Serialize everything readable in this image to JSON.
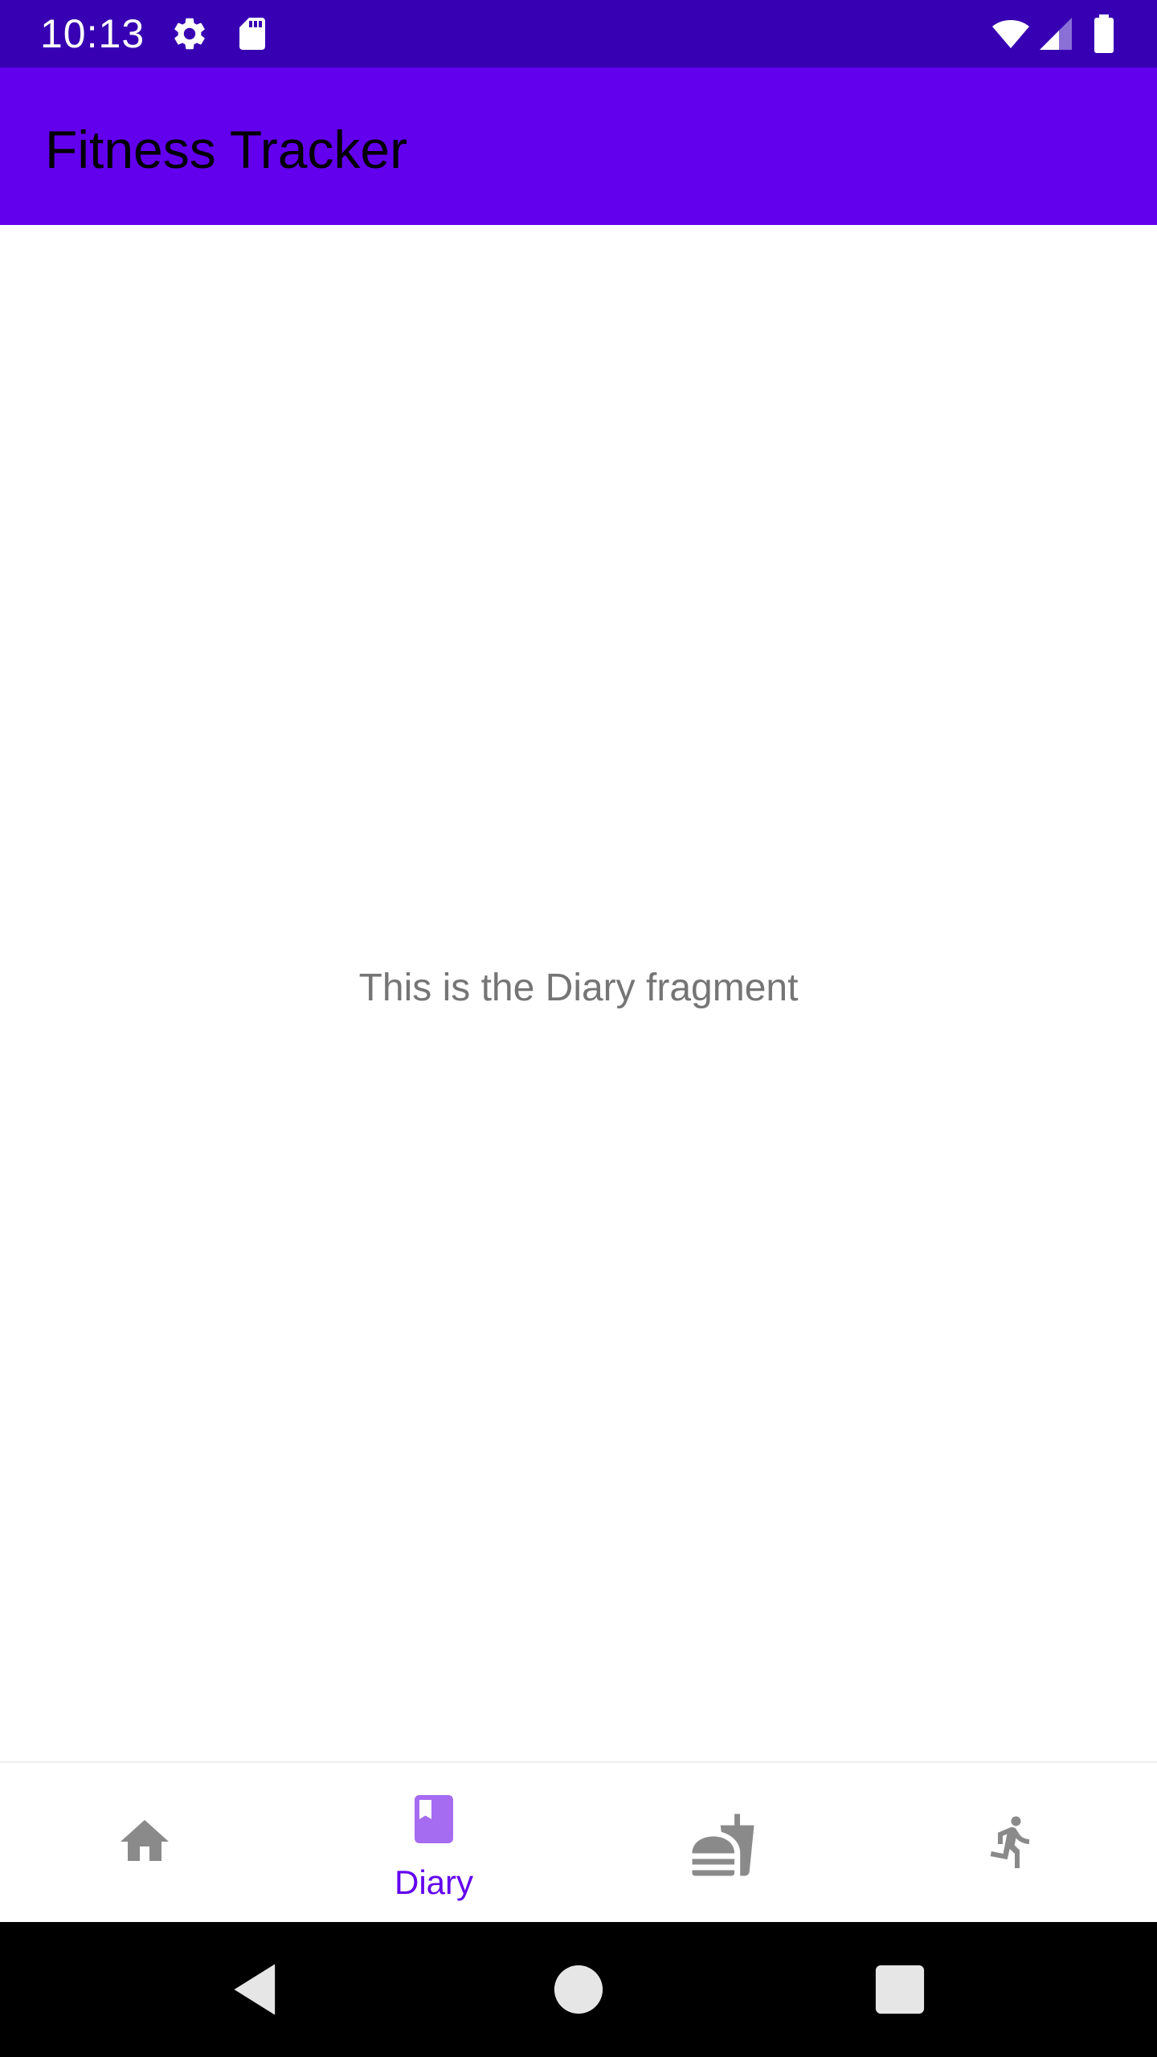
{
  "status_bar": {
    "time": "10:13",
    "icons": [
      "settings-icon",
      "sd-card-icon",
      "wifi-icon",
      "cellular-signal-icon",
      "battery-icon"
    ]
  },
  "app_bar": {
    "title": "Fitness Tracker"
  },
  "content": {
    "message": "This is the Diary fragment"
  },
  "bottom_nav": {
    "selected_index": 1,
    "items": [
      {
        "icon": "home-icon",
        "label": ""
      },
      {
        "icon": "book-icon",
        "label": "Diary"
      },
      {
        "icon": "fastfood-icon",
        "label": ""
      },
      {
        "icon": "run-icon",
        "label": ""
      }
    ]
  },
  "system_nav": {
    "buttons": [
      "back-icon",
      "home-circle-icon",
      "recents-icon"
    ]
  },
  "colors": {
    "status_bar": "#3700b3",
    "app_bar": "#6200ee",
    "selected": "#6200ee",
    "selected_icon": "#a56bf0",
    "unselected": "#8a8a8a",
    "body_text": "#757575"
  }
}
